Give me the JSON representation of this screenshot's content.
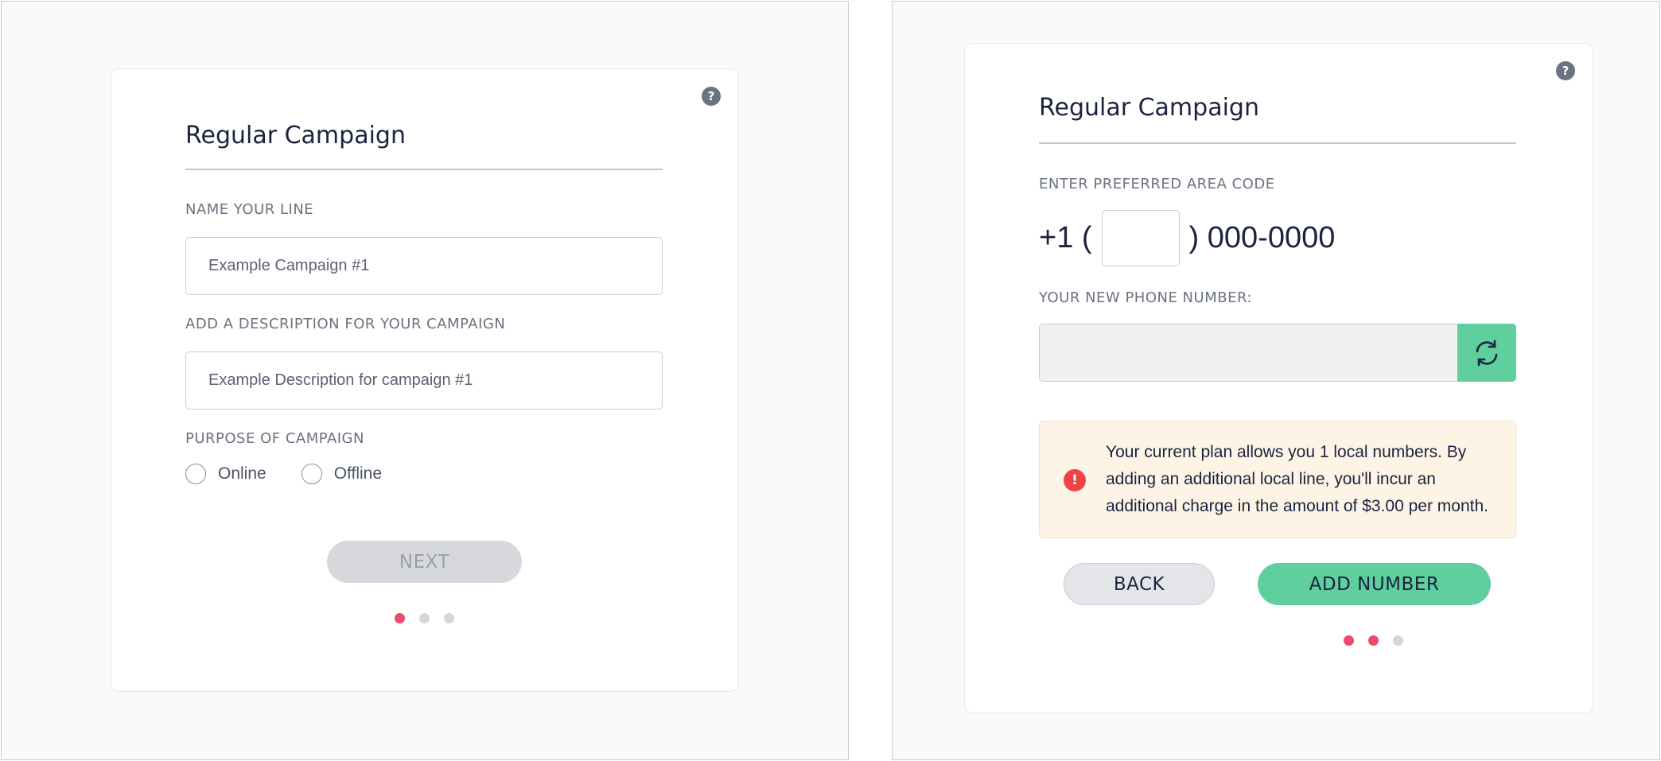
{
  "step1": {
    "title": "Regular Campaign",
    "name_label": "NAME YOUR LINE",
    "name_placeholder": "Example Campaign #1",
    "description_label": "ADD A DESCRIPTION FOR YOUR CAMPAIGN",
    "description_placeholder": "Example Description for campaign #1",
    "purpose_label": "PURPOSE OF CAMPAIGN",
    "purpose_options": [
      "Online",
      "Offline"
    ],
    "next_label": "NEXT",
    "current_step": 1,
    "total_steps": 3
  },
  "step2": {
    "title": "Regular Campaign",
    "area_code_label": "ENTER PREFERRED AREA CODE",
    "phone_prefix": "+1 (",
    "phone_suffix": ") 000-0000",
    "new_number_label": "YOUR NEW PHONE NUMBER:",
    "new_number_value": "",
    "alert_text": "Your current plan allows you 1 local numbers. By adding an additional local line, you'll incur an additional charge in the amount of $3.00 per month.",
    "back_label": "BACK",
    "add_label": "ADD NUMBER",
    "current_step": 2,
    "total_steps": 3
  },
  "colors": {
    "accent_green": "#5fcf9e",
    "dot_active": "#ec4a6e",
    "dot_inactive": "#d4d6da",
    "alert_bg": "#fdf4e6",
    "alert_icon": "#ef4444"
  },
  "icons": {
    "help": "question-mark",
    "refresh": "refresh-arrows",
    "alert": "exclamation-circle"
  }
}
